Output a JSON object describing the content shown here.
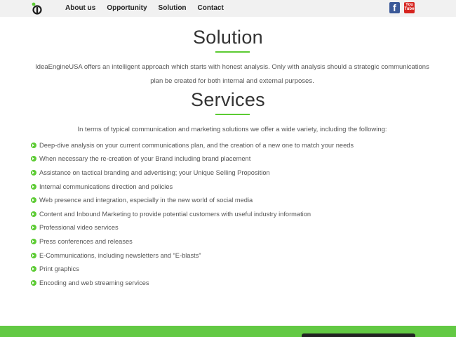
{
  "nav": {
    "items": [
      {
        "label": "About us"
      },
      {
        "label": "Opportunity"
      },
      {
        "label": "Solution"
      },
      {
        "label": "Contact"
      }
    ]
  },
  "social": {
    "facebook_glyph": "f",
    "youtube_top": "You",
    "youtube_bottom": "Tube"
  },
  "solution": {
    "title": "Solution",
    "text": "IdeaEngineUSA offers an intelligent approach which starts with honest analysis. Only with analysis should a strategic communications plan be created for both internal and external purposes."
  },
  "services": {
    "title": "Services",
    "intro": "In terms of typical communication and marketing solutions we offer a wide variety, including the following:",
    "items": [
      "Deep-dive analysis on your current communications plan, and the creation of a new one to match your needs",
      "When necessary the re-creation of your Brand including brand placement",
      "Assistance on tactical branding and advertising; your Unique Selling Proposition",
      "Internal communications direction and policies",
      "Web presence and integration, especially in the new world of social media",
      "Content and Inbound Marketing to provide potential customers with useful industry information",
      "Professional video services",
      "Press conferences and releases",
      "E-Communications, including newsletters and “E-blasts”",
      "Print graphics",
      "Encoding and web streaming services"
    ]
  },
  "colors": {
    "accent": "#5ccb33",
    "footer": "#63c944",
    "facebook": "#3b5998",
    "youtube": "#d6241f"
  },
  "icons": {
    "logo": "ideaengine-logo-icon",
    "bullet": "arrow-circle-right-icon"
  }
}
